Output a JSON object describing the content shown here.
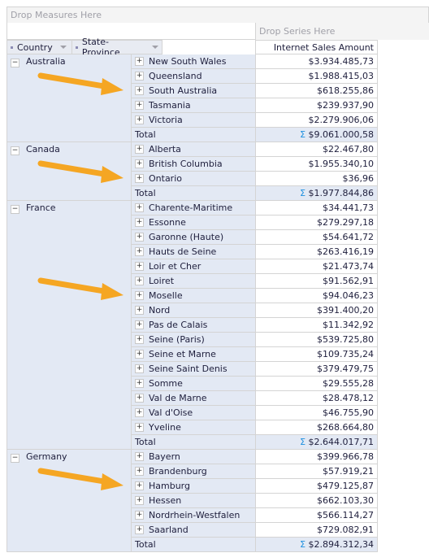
{
  "drop_measures": "Drop Measures Here",
  "drop_series": "Drop Series Here",
  "fields": {
    "country": "Country",
    "state": "State-Province"
  },
  "column_header": "Internet Sales Amount",
  "total_label": "Total",
  "sigma": "Σ",
  "arrow_color": "#f5a623",
  "groups": [
    {
      "country": "Australia",
      "states": [
        [
          "New South Wales",
          "$3.934.485,73"
        ],
        [
          "Queensland",
          "$1.988.415,03"
        ],
        [
          "South Australia",
          "$618.255,86"
        ],
        [
          "Tasmania",
          "$239.937,90"
        ],
        [
          "Victoria",
          "$2.279.906,06"
        ]
      ],
      "total": "$9.061.000,58",
      "arrow_to": "South Australia"
    },
    {
      "country": "Canada",
      "states": [
        [
          "Alberta",
          "$22.467,80"
        ],
        [
          "British Columbia",
          "$1.955.340,10"
        ],
        [
          "Ontario",
          "$36,96"
        ]
      ],
      "total": "$1.977.844,86",
      "arrow_to": "Ontario"
    },
    {
      "country": "France",
      "states": [
        [
          "Charente-Maritime",
          "$34.441,73"
        ],
        [
          "Essonne",
          "$279.297,18"
        ],
        [
          "Garonne (Haute)",
          "$54.641,72"
        ],
        [
          "Hauts de Seine",
          "$263.416,19"
        ],
        [
          "Loir et Cher",
          "$21.473,74"
        ],
        [
          "Loiret",
          "$91.562,91"
        ],
        [
          "Moselle",
          "$94.046,23"
        ],
        [
          "Nord",
          "$391.400,20"
        ],
        [
          "Pas de Calais",
          "$11.342,92"
        ],
        [
          "Seine (Paris)",
          "$539.725,80"
        ],
        [
          "Seine et Marne",
          "$109.735,24"
        ],
        [
          "Seine Saint Denis",
          "$379.479,75"
        ],
        [
          "Somme",
          "$29.555,28"
        ],
        [
          "Val de Marne",
          "$28.478,12"
        ],
        [
          "Val d'Oise",
          "$46.755,90"
        ],
        [
          "Yveline",
          "$268.664,80"
        ]
      ],
      "total": "$2.644.017,71",
      "arrow_to": "Moselle"
    },
    {
      "country": "Germany",
      "states": [
        [
          "Bayern",
          "$399.966,78"
        ],
        [
          "Brandenburg",
          "$57.919,21"
        ],
        [
          "Hamburg",
          "$479.125,87"
        ],
        [
          "Hessen",
          "$662.103,30"
        ],
        [
          "Nordrhein-Westfalen",
          "$566.114,27"
        ],
        [
          "Saarland",
          "$729.082,91"
        ]
      ],
      "total": "$2.894.312,34",
      "arrow_to": "Hamburg"
    }
  ]
}
